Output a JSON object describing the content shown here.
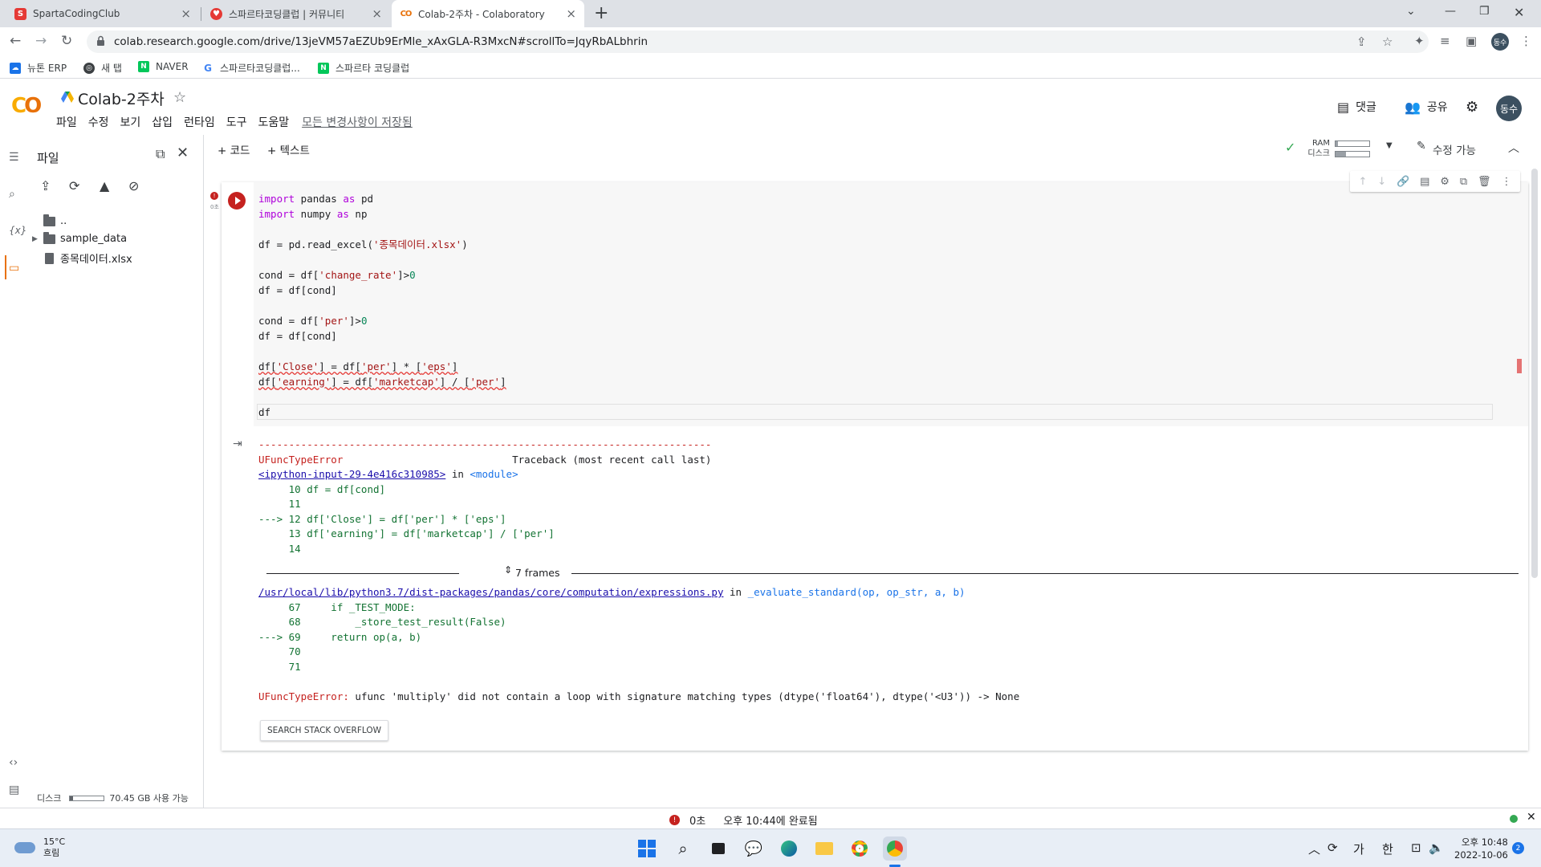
{
  "browser": {
    "tabs": [
      {
        "title": "SpartaCodingClub",
        "favicon_color": "#e53935"
      },
      {
        "title": "스파르타코딩클럽 | 커뮤니티",
        "favicon_color": "#e53935"
      },
      {
        "title": "Colab-2주차 - Colaboratory",
        "favicon_color": "#e8710a",
        "active": true
      }
    ],
    "url": "colab.research.google.com/drive/13jeVM57aEZUb9ErMle_xAxGLA-R3MxcN#scrollTo=JqyRbALbhrin",
    "profile_initials": "동수",
    "bookmarks": [
      {
        "label": "뉴톤 ERP",
        "icon": "cloud-icon"
      },
      {
        "label": "새 탭",
        "icon": "globe-icon"
      },
      {
        "label": "NAVER",
        "icon": "naver-icon"
      },
      {
        "label": "스파르타코딩클럽...",
        "icon": "google-icon"
      },
      {
        "label": "스파르타 코딩클럽",
        "icon": "naver-icon"
      }
    ]
  },
  "colab": {
    "logo": "CO",
    "title": "Colab-2주차",
    "menu": [
      "파일",
      "수정",
      "보기",
      "삽입",
      "런타임",
      "도구",
      "도움말"
    ],
    "saved_status": "모든 변경사항이 저장됨",
    "comment_label": "댓글",
    "share_label": "공유",
    "avatar": "동수",
    "add_code": "+ 코드",
    "add_text": "+ 텍스트",
    "ram_label": "RAM",
    "disk_label": "디스크",
    "ram_usage": 0.08,
    "disk_usage": 0.3,
    "edit_mode": "수정 가능"
  },
  "file_panel": {
    "title": "파일",
    "items": [
      {
        "name": "..",
        "type": "parent"
      },
      {
        "name": "sample_data",
        "type": "folder"
      },
      {
        "name": "종목데이터.xlsx",
        "type": "file"
      }
    ],
    "disk_label": "디스크",
    "disk_free": "70.45 GB 사용 가능",
    "disk_fill": 0.08
  },
  "cell": {
    "exec_time": "0초",
    "code_lines": [
      "import pandas as pd",
      "import numpy as np",
      "",
      "df = pd.read_excel('종목데이터.xlsx')",
      "",
      "cond = df['change_rate']>0",
      "df = df[cond]",
      "",
      "cond = df['per']>0",
      "df = df[cond]",
      "",
      "df['Close'] = df['per'] * ['eps']",
      "df['earning'] = df['marketcap'] / ['per']",
      "",
      "df"
    ],
    "output": {
      "separator": "---------------------------------------------------------------------------",
      "error_name": "UFuncTypeError",
      "traceback_label": "Traceback (most recent call last)",
      "input_link": "<ipython-input-29-4e416c310985>",
      "in_text": " in ",
      "module": "<module>",
      "lines1": [
        "     10 df = df[cond]",
        "     11 ",
        "---> 12 df['Close'] = df['per'] * ['eps']",
        "     13 df['earning'] = df['marketcap'] / ['per']",
        "     14 "
      ],
      "frames_label": "7 frames",
      "path_link": "/usr/local/lib/python3.7/dist-packages/pandas/core/computation/expressions.py",
      "func": "_evaluate_standard(op, op_str, a, b)",
      "lines2": [
        "     67     if _TEST_MODE:",
        "     68         _store_test_result(False)",
        "---> 69     return op(a, b)",
        "     70 ",
        "     71 "
      ],
      "final_error_name": "UFuncTypeError:",
      "final_error_msg": " ufunc 'multiply' did not contain a loop with signature matching types (dtype('float64'), dtype('<U3')) -> None",
      "so_button": "SEARCH STACK OVERFLOW"
    }
  },
  "statusbar": {
    "time": "0초",
    "completed": "오후 10:44에 완료됨"
  },
  "taskbar": {
    "temp": "15°C",
    "weather": "흐림",
    "ime": "가",
    "lang": "한",
    "time": "오후 10:48",
    "date": "2022-10-06",
    "notifications": "2"
  }
}
